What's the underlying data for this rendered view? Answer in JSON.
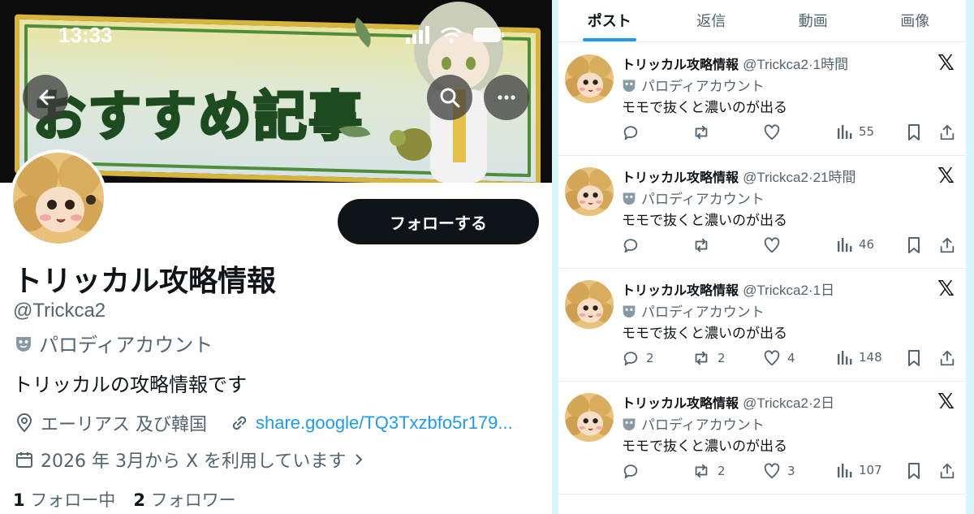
{
  "status_bar": {
    "time": "13:33"
  },
  "banner": {
    "title": "おすすめ記事"
  },
  "profile": {
    "follow_label": "フォローする",
    "name": "トリッカル攻略情報",
    "handle": "@Trickca2",
    "parody_label": "パロディアカウント",
    "bio": "トリッカルの攻略情報です",
    "location": "エーリアス 及び韓国",
    "link": "share.google/TQ3Txzbfo5r179...",
    "joined": "2026 年 3月から X を利用しています",
    "following_count": "1",
    "following_label": "フォロー中",
    "followers_count": "2",
    "followers_label": "フォロワー"
  },
  "tabs": [
    {
      "label": "ポスト",
      "active": true
    },
    {
      "label": "返信",
      "active": false
    },
    {
      "label": "動画",
      "active": false
    },
    {
      "label": "画像",
      "active": false
    }
  ],
  "posts": [
    {
      "author": "トリッカル攻略情報",
      "handle": "@Trickca2",
      "time": "·1時間",
      "parody": "パロディアカウント",
      "text": "モモで抜くと濃いのが出る",
      "replies": "",
      "reposts": "",
      "likes": "",
      "views": "55"
    },
    {
      "author": "トリッカル攻略情報",
      "handle": "@Trickca2",
      "time": "·21時間",
      "parody": "パロディアカウント",
      "text": "モモで抜くと濃いのが出る",
      "replies": "",
      "reposts": "",
      "likes": "",
      "views": "46"
    },
    {
      "author": "トリッカル攻略情報",
      "handle": "@Trickca2",
      "time": "·1日",
      "parody": "パロディアカウント",
      "text": "モモで抜くと濃いのが出る",
      "replies": "2",
      "reposts": "2",
      "likes": "4",
      "views": "148"
    },
    {
      "author": "トリッカル攻略情報",
      "handle": "@Trickca2",
      "time": "·2日",
      "parody": "パロディアカウント",
      "text": "モモで抜くと濃いのが出る",
      "replies": "",
      "reposts": "2",
      "likes": "3",
      "views": "107"
    }
  ],
  "colors": {
    "accent": "#1d9bf0",
    "text": "#0f1419",
    "muted": "#536471",
    "button": "#0f1419"
  },
  "icons": [
    "back-arrow-icon",
    "search-icon",
    "more-icon",
    "parody-mask-icon",
    "location-icon",
    "link-icon",
    "calendar-icon",
    "chevron-right-icon",
    "x-logo-icon",
    "reply-icon",
    "repost-icon",
    "like-icon",
    "views-icon",
    "bookmark-icon",
    "share-icon"
  ]
}
